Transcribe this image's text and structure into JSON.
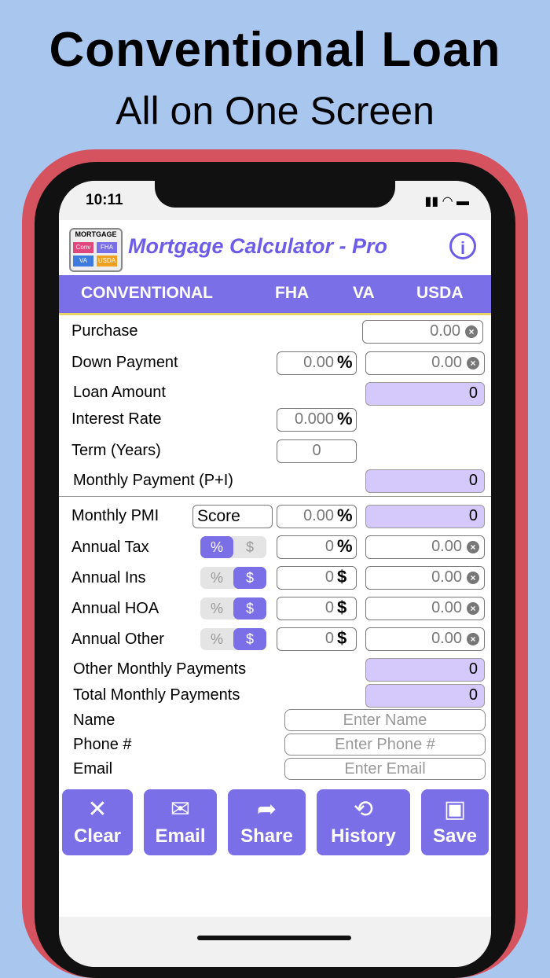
{
  "headline": {
    "title": "Conventional Loan",
    "subtitle": "All on One Screen"
  },
  "status": {
    "time": "10:11",
    "icons": "▮▮ ◠ ▬"
  },
  "app": {
    "title": "Mortgage Calculator - Pro",
    "info_icon": "i",
    "logo": {
      "title": "MORTGAGE",
      "cells": [
        "Conv",
        "FHA",
        "VA",
        "USDA"
      ]
    }
  },
  "tabs": [
    "CONVENTIONAL",
    "FHA",
    "VA",
    "USDA"
  ],
  "fields": {
    "purchase": {
      "label": "Purchase",
      "value": "0.00"
    },
    "down_payment": {
      "label": "Down Payment",
      "percent": "0.00",
      "suffix": "%",
      "value": "0.00"
    },
    "loan_amount": {
      "label": "Loan Amount",
      "value": "0"
    },
    "interest_rate": {
      "label": "Interest Rate",
      "value": "0.000",
      "suffix": "%"
    },
    "term": {
      "label": "Term (Years)",
      "value": "0"
    },
    "monthly_payment": {
      "label": "Monthly Payment (P+I)",
      "value": "0"
    },
    "pmi": {
      "label": "Monthly PMI",
      "score": "Score",
      "percent": "0.00",
      "suffix": "%",
      "value": "0"
    },
    "annual_tax": {
      "label": "Annual Tax",
      "seg_pct": "%",
      "seg_dollar": "$",
      "input": "0",
      "suffix": "%",
      "value": "0.00"
    },
    "annual_ins": {
      "label": "Annual Ins",
      "seg_pct": "%",
      "seg_dollar": "$",
      "input": "0",
      "suffix": "$",
      "value": "0.00"
    },
    "annual_hoa": {
      "label": "Annual HOA",
      "seg_pct": "%",
      "seg_dollar": "$",
      "input": "0",
      "suffix": "$",
      "value": "0.00"
    },
    "annual_other": {
      "label": "Annual Other",
      "seg_pct": "%",
      "seg_dollar": "$",
      "input": "0",
      "suffix": "$",
      "value": "0.00"
    },
    "other_monthly": {
      "label": "Other Monthly Payments",
      "value": "0"
    },
    "total_monthly": {
      "label": "Total Monthly Payments",
      "value": "0"
    },
    "name": {
      "label": "Name",
      "placeholder": "Enter Name"
    },
    "phone": {
      "label": "Phone #",
      "placeholder": "Enter Phone #"
    },
    "email": {
      "label": "Email",
      "placeholder": "Enter Email"
    }
  },
  "clear_glyph": "×",
  "buttons": [
    {
      "label": "Clear",
      "icon": "✕"
    },
    {
      "label": "Email",
      "icon": "✉"
    },
    {
      "label": "Share",
      "icon": "➦"
    },
    {
      "label": "History",
      "icon": "⟲"
    },
    {
      "label": "Save",
      "icon": "▣"
    }
  ]
}
